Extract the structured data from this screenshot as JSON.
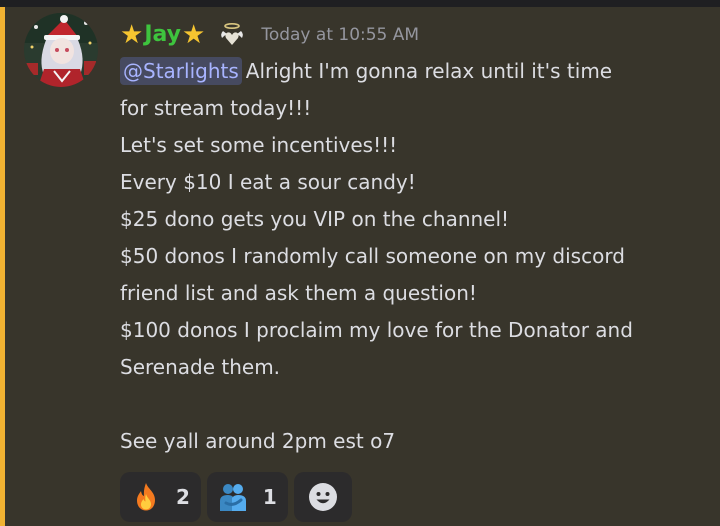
{
  "message": {
    "author": "Jay",
    "timestamp": "Today at 10:55 AM",
    "mention": "@Starlights",
    "lines": [
      "Alright I'm gonna relax until it's time",
      "for stream today!!!",
      "Let's set some incentives!!!",
      "Every $10 I eat a sour candy!",
      "$25 dono gets you VIP on the channel!",
      "$50 donos I randomly call someone on my discord",
      "friend list and ask them a question!",
      "$100 donos I proclaim my love for the Donator and",
      "Serenade them.",
      "",
      "See yall around 2pm est o7"
    ],
    "decorations": {
      "name_star_left": "★",
      "name_star_right": "★"
    }
  },
  "reactions": [
    {
      "icon": "fire-icon",
      "count": "2"
    },
    {
      "icon": "people-hugging-icon",
      "count": "1"
    }
  ],
  "colors": {
    "highlight_bar": "#f0b232",
    "username": "#3ec43e",
    "mention_text": "#a8b4ff",
    "mention_bg": "#464a60",
    "message_bg": "#38352b"
  }
}
